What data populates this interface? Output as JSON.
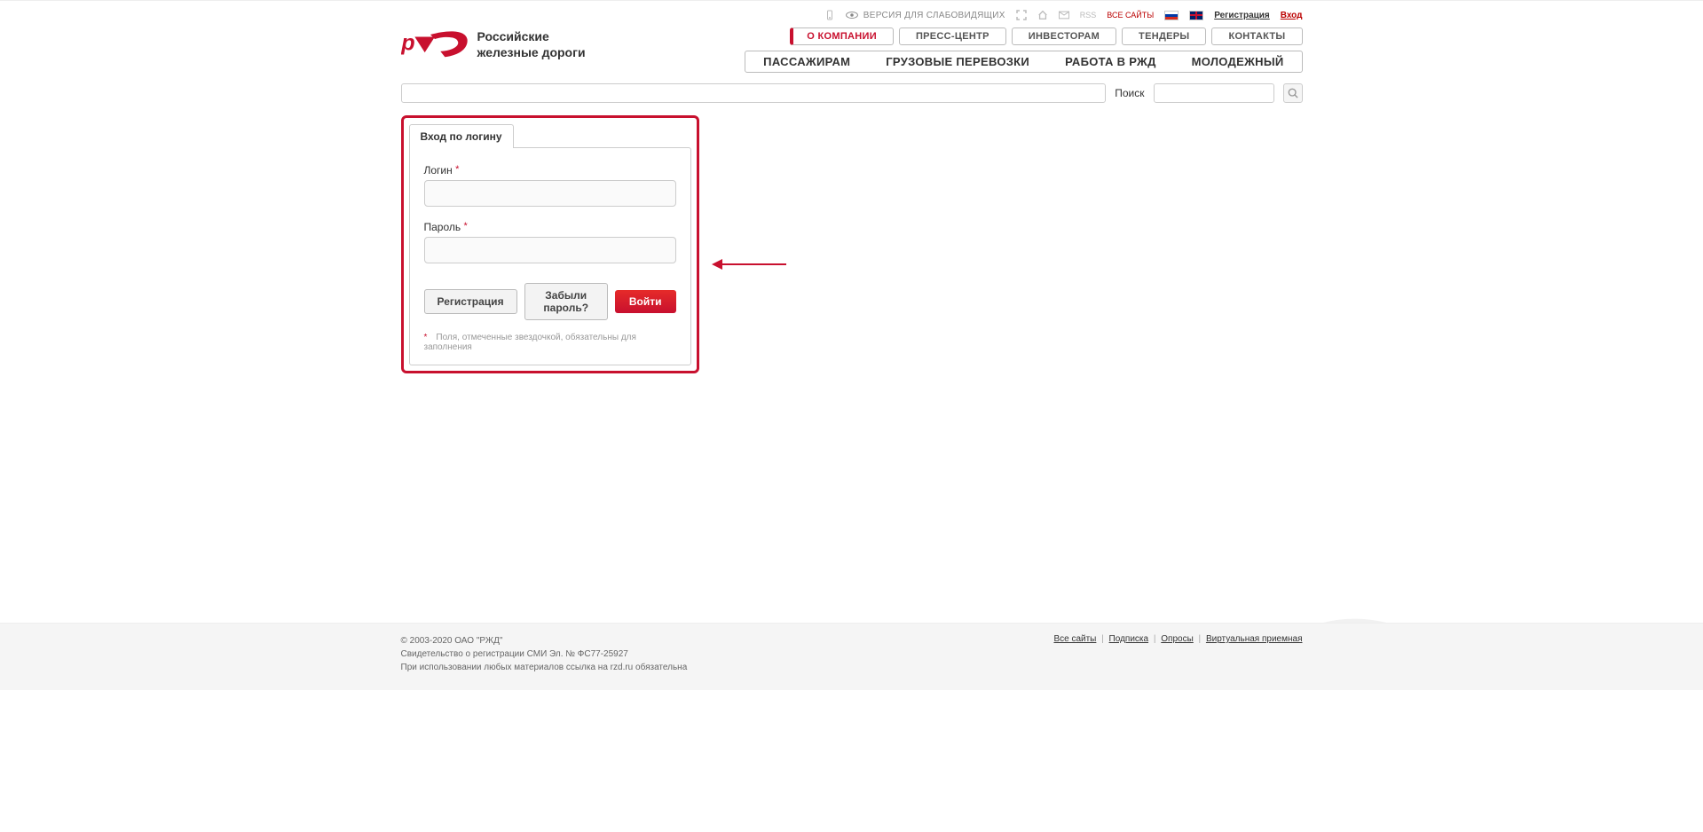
{
  "logo_text_line1": "Российские",
  "logo_text_line2": "железные дороги",
  "top_bar": {
    "accessibility": "ВЕРСИЯ ДЛЯ СЛАБОВИДЯЩИХ",
    "rss": "RSS",
    "all_sites": "ВСЕ САЙТЫ",
    "register": "Регистрация",
    "login": "Вход"
  },
  "nav1": {
    "about": "О КОМПАНИИ",
    "press": "ПРЕСС-ЦЕНТР",
    "investors": "ИНВЕСТОРАМ",
    "tenders": "ТЕНДЕРЫ",
    "contacts": "КОНТАКТЫ"
  },
  "nav2": {
    "passengers": "ПАССАЖИРАМ",
    "freight": "ГРУЗОВЫЕ ПЕРЕВОЗКИ",
    "work": "РАБОТА В РЖД",
    "youth": "МОЛОДЕЖНЫЙ"
  },
  "search": {
    "label": "Поиск"
  },
  "login_form": {
    "tab": "Вход по логину",
    "login_label": "Логин",
    "password_label": "Пароль",
    "register_btn": "Регистрация",
    "forgot_btn": "Забыли пароль?",
    "submit_btn": "Войти",
    "note": "Поля, отмеченные звездочкой, обязательны для заполнения",
    "required_mark": "*"
  },
  "footer": {
    "copyright": "© 2003-2020 ОАО \"РЖД\"",
    "cert": "Свидетельство о регистрации СМИ Эл. № ФС77-25927",
    "link_note": "При использовании любых материалов ссылка на rzd.ru обязательна",
    "all_sites": "Все сайты",
    "subscribe": "Подписка",
    "polls": "Опросы",
    "virtual": "Виртуальная приемная",
    "sep": "|"
  }
}
